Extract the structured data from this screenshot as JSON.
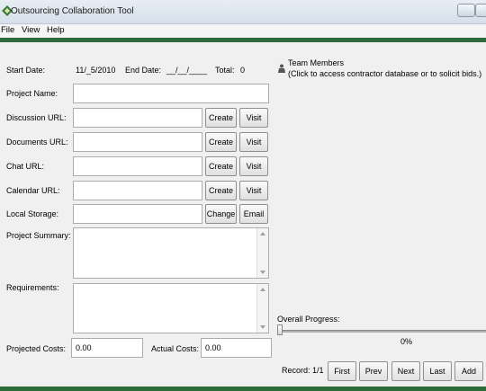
{
  "window": {
    "title": "Outsourcing Collaboration Tool"
  },
  "menu": {
    "items": [
      "File",
      "View",
      "Help"
    ]
  },
  "dates": {
    "start_label": "Start Date:",
    "start_value": "11/_5/2010",
    "end_label": "End Date:",
    "end_value": "__/__/____",
    "total_label": "Total:",
    "total_value": "0"
  },
  "team": {
    "title": "Team Members",
    "hint": "(Click to access contractor database or to solicit bids.)"
  },
  "project": {
    "name_label": "Project Name:",
    "discussion_label": "Discussion URL:",
    "documents_label": "Documents URL:",
    "chat_label": "Chat URL:",
    "calendar_label": "Calendar URL:",
    "storage_label": "Local Storage:",
    "summary_label": "Project Summary:",
    "requirements_label": "Requirements:",
    "projected_label": "Projected Costs:",
    "projected_value": "0.00",
    "actual_label": "Actual Costs:",
    "actual_value": "0.00"
  },
  "buttons": {
    "create": "Create",
    "visit": "Visit",
    "change": "Change",
    "email": "Email"
  },
  "progress": {
    "label": "Overall Progress:",
    "value_text": "0%",
    "value": 0
  },
  "nav": {
    "record_label": "Record: 1/1",
    "first": "First",
    "prev": "Prev",
    "next": "Next",
    "last": "Last",
    "add": "Add"
  },
  "colors": {
    "accent": "#2e6b3a"
  },
  "icons": {
    "app": "app-icon",
    "team": "team-icon"
  }
}
